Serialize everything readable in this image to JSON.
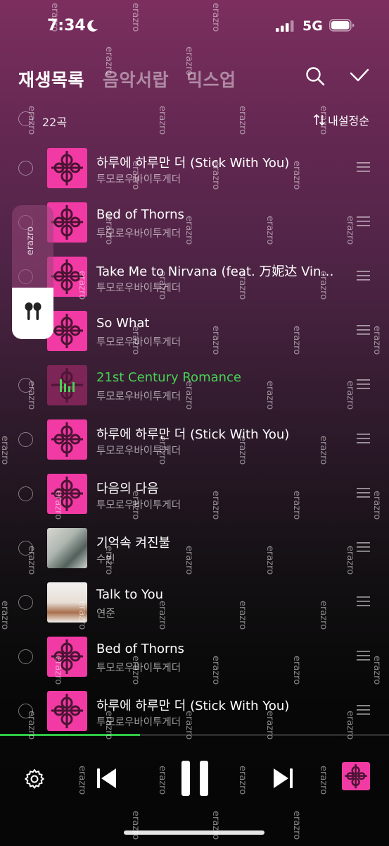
{
  "status_bar": {
    "time": "7:34",
    "network": "5G"
  },
  "header": {
    "tabs": [
      {
        "label": "재생목록",
        "active": true
      },
      {
        "label": "음악서랍",
        "active": false
      },
      {
        "label": "믹스업",
        "active": false
      }
    ]
  },
  "list_toolbar": {
    "count": "22곡",
    "sort": "내설정순"
  },
  "tracks": [
    {
      "title": "하루에 하루만 더 (Stick With You)",
      "artist": "투모로우바이투게더",
      "cover": "pink"
    },
    {
      "title": "Bed of Thorns",
      "artist": "투모로우바이투게더",
      "cover": "pink"
    },
    {
      "title": "Take Me to Nirvana (feat. 万妮达 Vinida Weng)",
      "artist": "투모로우바이투게더",
      "cover": "pink"
    },
    {
      "title": "So What",
      "artist": "투모로우바이투게더",
      "cover": "pink"
    },
    {
      "title": "21st Century Romance",
      "artist": "투모로우바이투게더",
      "cover": "pink",
      "now_playing": true
    },
    {
      "title": "하루에 하루만 더 (Stick With You)",
      "artist": "투모로우바이투게더",
      "cover": "pink"
    },
    {
      "title": "다음의 다음",
      "artist": "투모로우바이투게더",
      "cover": "pink"
    },
    {
      "title": "기억속 켜진불",
      "artist": "수빈",
      "cover": "photo"
    },
    {
      "title": "Talk to You",
      "artist": "연준",
      "cover": "photo"
    },
    {
      "title": "Bed of Thorns",
      "artist": "투모로우바이투게더",
      "cover": "pink"
    },
    {
      "title": "하루에 하루만 더 (Stick With You)",
      "artist": "투모로우바이투게더",
      "cover": "pink"
    }
  ],
  "airpods_widget": {
    "label": "erazro",
    "icon": "airpods-icon"
  },
  "player": {
    "progress": 0.36,
    "state": "playing"
  },
  "watermark": "erazro",
  "colors": {
    "accent_green": "#46d254",
    "cover_pink": "#f13aa4",
    "progress_green": "#2fc845"
  }
}
